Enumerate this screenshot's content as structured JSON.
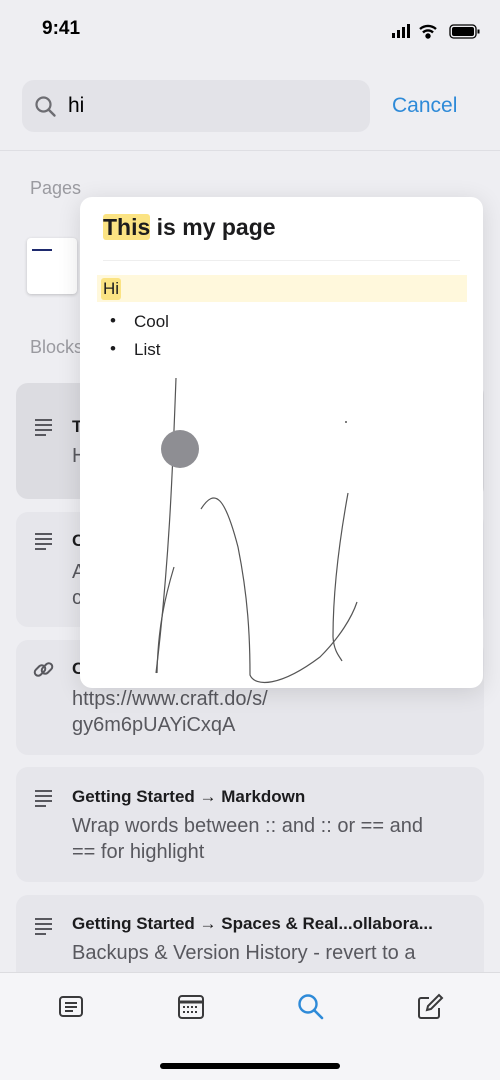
{
  "status": {
    "time": "9:41"
  },
  "search": {
    "query": "hi",
    "cancel": "Cancel"
  },
  "sections": {
    "pages": "Pages",
    "blocks": "Blocks"
  },
  "results": [
    {
      "icon": "text-lines-icon",
      "title": "T",
      "body": "H"
    },
    {
      "icon": "text-lines-icon",
      "title": "C",
      "body": "A\nc"
    },
    {
      "icon": "link-icon",
      "title": "C",
      "body": "https://www.craft.do/s/\ngy6m6pUAYiCxqA"
    },
    {
      "icon": "text-lines-icon",
      "title": "Getting Started → Markdown",
      "body": "Wrap words between :: and :: or == and\n== for highlight"
    },
    {
      "icon": "text-lines-icon",
      "title": "Getting Started → Spaces & Real...ollabora...",
      "body": "Backups & Version History - revert to a"
    }
  ],
  "preview": {
    "title_highlight": "This",
    "title_rest": " is my page",
    "highlight_block": "Hi",
    "bullets": [
      "Cool",
      "List"
    ],
    "highlight_color": "#fbe383"
  },
  "tabbar": {
    "items": [
      "documents-icon",
      "calendar-icon",
      "search-icon",
      "compose-icon"
    ],
    "active": "search-icon",
    "accent": "#2e8ad8"
  }
}
